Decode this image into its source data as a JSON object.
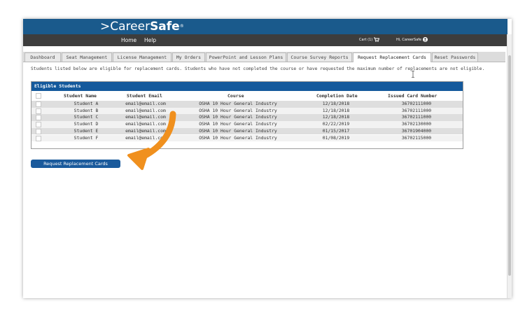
{
  "brand": {
    "prefix": ">",
    "career": "Career",
    "safe": "Safe",
    "tm": "®"
  },
  "nav": {
    "home": "Home",
    "help": "Help",
    "cart": "Cart (1)",
    "greeting": "Hi, CareerSafe"
  },
  "tabs": [
    {
      "label": "Dashboard",
      "active": false
    },
    {
      "label": "Seat Management",
      "active": false
    },
    {
      "label": "License Management",
      "active": false
    },
    {
      "label": "My Orders",
      "active": false
    },
    {
      "label": "PowerPoint and Lesson Plans",
      "active": false
    },
    {
      "label": "Course Survey Reports",
      "active": false
    },
    {
      "label": "Request Replacement Cards",
      "active": true
    },
    {
      "label": "Reset Passwords",
      "active": false
    }
  ],
  "notice": "Students listed below are eligible for replacement cards. Students who have not completed the course or have requested the maximum number of replacements are not eligible.",
  "panel": {
    "title": "Eligible Students",
    "columns": {
      "name": "Student Name",
      "email": "Student Email",
      "course": "Course",
      "date": "Completion Date",
      "card": "Issued Card Number"
    },
    "rows": [
      {
        "name": "Student A",
        "email": "email@email.com",
        "course": "OSHA 10 Hour General Industry",
        "date": "12/18/2018",
        "card": "36702111000"
      },
      {
        "name": "Student B",
        "email": "email@email.com",
        "course": "OSHA 10 Hour General Industry",
        "date": "12/18/2018",
        "card": "36702111000"
      },
      {
        "name": "Student C",
        "email": "email@email.com",
        "course": "OSHA 10 Hour General Industry",
        "date": "12/18/2018",
        "card": "36702111000"
      },
      {
        "name": "Student D",
        "email": "email@email.com",
        "course": "OSHA 10 Hour General Industry",
        "date": "02/22/2019",
        "card": "36702130000"
      },
      {
        "name": "Student E",
        "email": "email@email.com",
        "course": "OSHA 10 Hour General Industry",
        "date": "01/15/2017",
        "card": "36701904000"
      },
      {
        "name": "Student F",
        "email": "email@email.com",
        "course": "OSHA 10 Hour General Industry",
        "date": "01/08/2019",
        "card": "36702115000"
      }
    ]
  },
  "button": {
    "label": "Request Replacement Cards"
  },
  "icons": {
    "cart": "cart-icon",
    "user": "user-icon",
    "arrow": "annotation-arrow-icon",
    "cursor": "text-cursor-icon"
  },
  "colors": {
    "brand_blue": "#1a5a8c",
    "nav_dark": "#3d3d3d",
    "panel_blue": "#14599c",
    "button_blue": "#1a5a9c",
    "arrow_orange": "#f0901e"
  }
}
